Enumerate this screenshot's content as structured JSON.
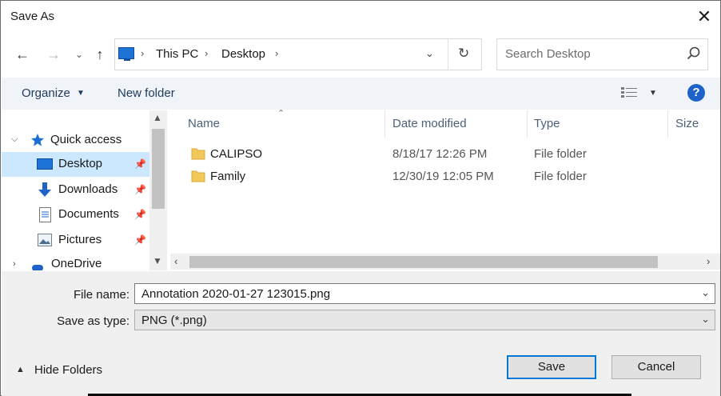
{
  "window": {
    "title": "Save As"
  },
  "address": {
    "crumbs": [
      "This PC",
      "Desktop"
    ]
  },
  "search": {
    "placeholder": "Search Desktop"
  },
  "toolbar": {
    "organize": "Organize",
    "new_folder": "New folder",
    "help": "?"
  },
  "nav": {
    "quick_access": "Quick access",
    "items": [
      "Desktop",
      "Downloads",
      "Documents",
      "Pictures"
    ],
    "partial": "OneDrive"
  },
  "columns": [
    "Name",
    "Date modified",
    "Type",
    "Size"
  ],
  "files": [
    {
      "name": "CALIPSO",
      "date": "8/18/17 12:26 PM",
      "type": "File folder"
    },
    {
      "name": "Family",
      "date": "12/30/19 12:05 PM",
      "type": "File folder"
    }
  ],
  "form": {
    "file_name_label": "File name:",
    "file_name_value": "Annotation 2020-01-27 123015.png",
    "type_label": "Save as type:",
    "type_value": "PNG (*.png)"
  },
  "buttons": {
    "hide_folders": "Hide Folders",
    "save": "Save",
    "cancel": "Cancel"
  },
  "colors": {
    "accent": "#0078d7",
    "selection": "#cce8ff",
    "toolbar_bg": "#f0f4f9",
    "folder": "#f3c85a"
  }
}
